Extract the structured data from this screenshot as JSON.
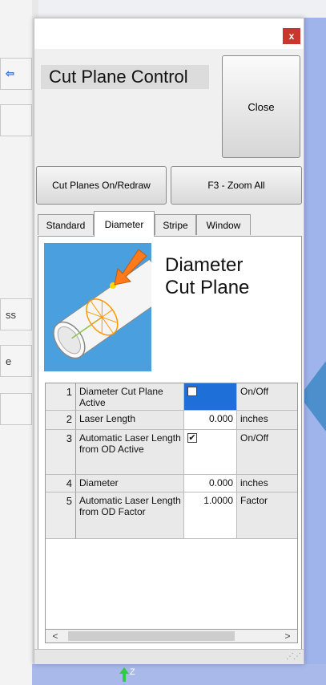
{
  "background": {
    "left_buttons": [
      "",
      "",
      "",
      "ss",
      "e",
      ""
    ],
    "axis_label": "Z"
  },
  "dialog": {
    "close_x": "x",
    "title": "Cut Plane Control",
    "close_label": "Close",
    "btn_cut_planes": "Cut Planes On/Redraw",
    "btn_zoom_all": "F3 - Zoom All",
    "tabs": [
      "Standard",
      "Diameter",
      "Stripe",
      "Window"
    ],
    "active_tab": "Diameter",
    "heading_line1": "Diameter",
    "heading_line2": "Cut Plane",
    "rows": [
      {
        "num": "1",
        "name": "Diameter Cut Plane Active",
        "value": "",
        "unit": "On/Off",
        "checkbox": true,
        "checked": false,
        "selected": true
      },
      {
        "num": "2",
        "name": "Laser Length",
        "value": "0.000",
        "unit": "inches",
        "checkbox": false,
        "checked": false,
        "selected": false
      },
      {
        "num": "3",
        "name": "Automatic Laser Length from OD Active",
        "value": "",
        "unit": "On/Off",
        "checkbox": true,
        "checked": true,
        "selected": false
      },
      {
        "num": "4",
        "name": "Diameter",
        "value": "0.000",
        "unit": "inches",
        "checkbox": false,
        "checked": false,
        "selected": false
      },
      {
        "num": "5",
        "name": "Automatic Laser Length from OD Factor",
        "value": "1.0000",
        "unit": "Factor",
        "checkbox": false,
        "checked": false,
        "selected": false
      }
    ],
    "scroll_left": "<",
    "scroll_right": ">"
  },
  "colors": {
    "selected_cell": "#1e6fd8",
    "close_x_bg": "#c9372c",
    "callout": "#4c8fcc",
    "viewport": "#9fb4ea"
  }
}
